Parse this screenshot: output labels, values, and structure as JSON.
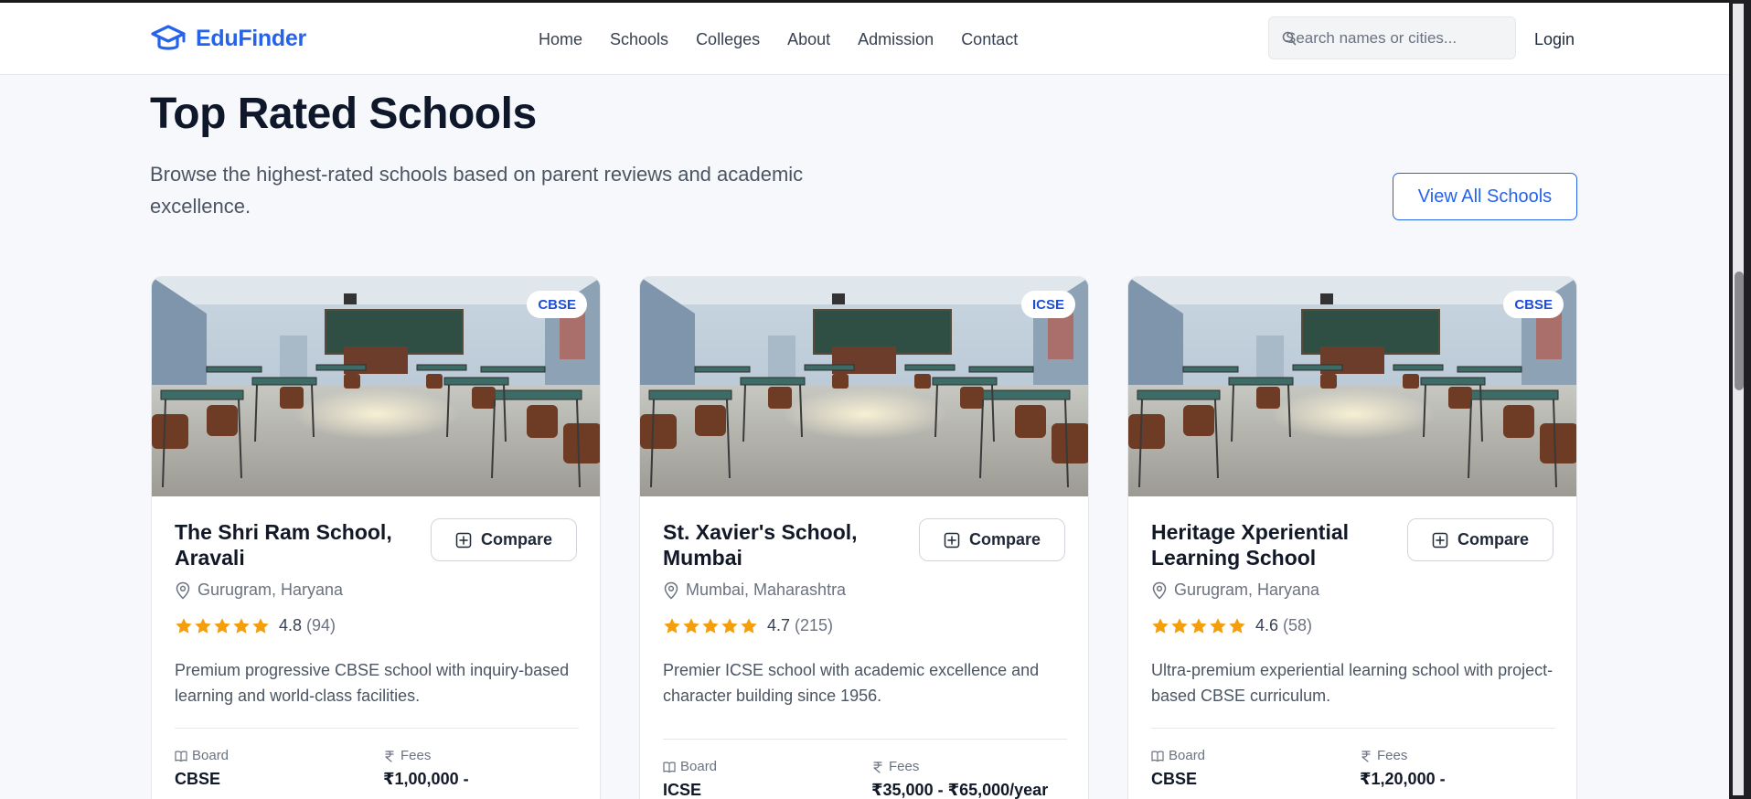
{
  "header": {
    "brand": "EduFinder",
    "nav": [
      "Home",
      "Schools",
      "Colleges",
      "About",
      "Admission",
      "Contact"
    ],
    "search_placeholder": "Search names or cities...",
    "login": "Login"
  },
  "section": {
    "title": "Top Rated Schools",
    "subtitle": "Browse the highest-rated schools based on parent reviews and academic excellence.",
    "view_all": "View All Schools"
  },
  "schools": [
    {
      "badge": "CBSE",
      "name": "The Shri Ram School, Aravali",
      "compare": "Compare",
      "location": "Gurugram, Haryana",
      "rating": "4.8",
      "reviews": "(94)",
      "description": "Premium progressive CBSE school with inquiry-based learning and world-class facilities.",
      "board_label": "Board",
      "board": "CBSE",
      "fees_label": "Fees",
      "fees": "₹1,00,000 -"
    },
    {
      "badge": "ICSE",
      "name": "St. Xavier's School, Mumbai",
      "compare": "Compare",
      "location": "Mumbai, Maharashtra",
      "rating": "4.7",
      "reviews": "(215)",
      "description": "Premier ICSE school with academic excellence and character building since 1956.",
      "board_label": "Board",
      "board": "ICSE",
      "fees_label": "Fees",
      "fees": "₹35,000 - ₹65,000/year"
    },
    {
      "badge": "CBSE",
      "name": "Heritage Xperiential Learning School",
      "compare": "Compare",
      "location": "Gurugram, Haryana",
      "rating": "4.6",
      "reviews": "(58)",
      "description": "Ultra-premium experiential learning school with project-based CBSE curriculum.",
      "board_label": "Board",
      "board": "CBSE",
      "fees_label": "Fees",
      "fees": "₹1,20,000 -"
    }
  ],
  "colors": {
    "brand": "#2563eb",
    "star": "#f59e0b",
    "text_dark": "#0f172a",
    "background": "#f7f8fb"
  },
  "icons": {
    "logo": "graduation-cap-icon",
    "search": "search-icon",
    "compare": "plus-square-icon",
    "location": "map-pin-icon",
    "star": "star-icon",
    "board": "book-icon",
    "fees": "rupee-icon"
  }
}
